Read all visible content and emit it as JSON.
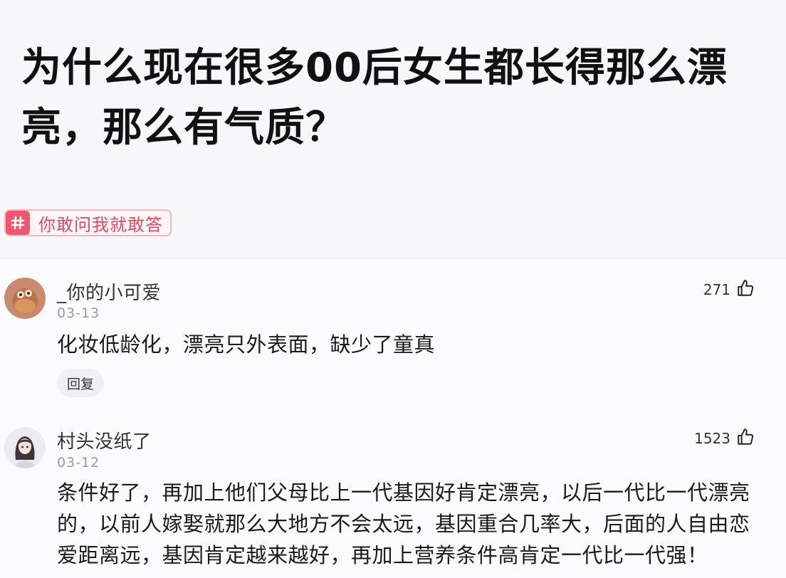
{
  "question": {
    "title": "为什么现在很多00后女生都长得那么漂亮，那么有气质？",
    "topic_tag": "你敢问我就敢答"
  },
  "comments": [
    {
      "username": "_你的小可爱",
      "date": "03-13",
      "likes": "271",
      "text": "化妆低龄化，漂亮只外表面，缺少了童真",
      "reply_label": "回复"
    },
    {
      "username": "村头没纸了",
      "date": "03-12",
      "likes": "1523",
      "text": "条件好了，再加上他们父母比上一代基因好肯定漂亮，以后一代比一代漂亮的，以前人嫁娶就那么大地方不会太远，基因重合几率大，后面的人自由恋爱距离远，基因肯定越来越好，再加上营养条件高肯定一代比一代强！"
    }
  ],
  "icons": {
    "tag": "hash-icon",
    "like": "thumbs-up-icon"
  },
  "colors": {
    "tag_accent": "#f0566f",
    "tag_text": "#e24a63",
    "background": "#f7f7f9"
  }
}
